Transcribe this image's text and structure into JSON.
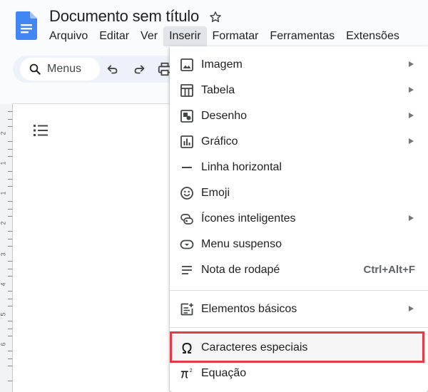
{
  "app": {
    "title": "Documento sem título",
    "icon": "google-docs-icon",
    "accent": "#4285f4"
  },
  "menubar": {
    "items": [
      {
        "label": "Arquivo"
      },
      {
        "label": "Editar"
      },
      {
        "label": "Ver"
      },
      {
        "label": "Inserir",
        "active": true
      },
      {
        "label": "Formatar"
      },
      {
        "label": "Ferramentas"
      },
      {
        "label": "Extensões"
      }
    ]
  },
  "toolbar": {
    "search_label": "Menus",
    "buttons": [
      "undo-icon",
      "redo-icon",
      "print-icon"
    ]
  },
  "ruler": {
    "numbers": [
      "2",
      "1",
      "1",
      "2",
      "3",
      "4",
      "5",
      "6"
    ]
  },
  "insert_menu": {
    "items": [
      {
        "label": "Imagem",
        "icon": "image-icon",
        "submenu": true
      },
      {
        "label": "Tabela",
        "icon": "table-icon",
        "submenu": true
      },
      {
        "label": "Desenho",
        "icon": "drawing-icon",
        "submenu": true
      },
      {
        "label": "Gráfico",
        "icon": "chart-icon",
        "submenu": true
      },
      {
        "label": "Linha horizontal",
        "icon": "horizontal-line-icon",
        "submenu": false
      },
      {
        "label": "Emoji",
        "icon": "emoji-icon",
        "submenu": false
      },
      {
        "label": "Ícones inteligentes",
        "icon": "smart-chips-icon",
        "submenu": true
      },
      {
        "label": "Menu suspenso",
        "icon": "dropdown-icon",
        "submenu": false
      },
      {
        "label": "Nota de rodapé",
        "icon": "footnote-icon",
        "submenu": false,
        "shortcut": "Ctrl+Alt+F"
      },
      {
        "label": "Elementos básicos",
        "icon": "building-blocks-icon",
        "submenu": true
      },
      {
        "label": "Caracteres especiais",
        "icon": "omega-icon",
        "submenu": false,
        "highlighted": true
      },
      {
        "label": "Equação",
        "icon": "pi-icon",
        "submenu": false
      }
    ],
    "highlight_color": "#e53945"
  }
}
